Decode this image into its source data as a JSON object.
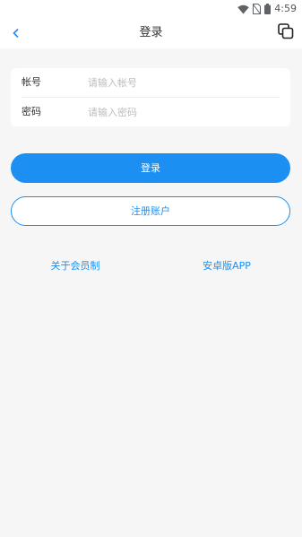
{
  "status_bar": {
    "time": "4:59",
    "icons": [
      "wifi-icon",
      "no-sim-icon",
      "battery-icon"
    ]
  },
  "nav": {
    "title": "登录",
    "back_icon": "chevron-left-icon",
    "action_icon": "copy-window-icon"
  },
  "form": {
    "account": {
      "label": "帐号",
      "value": "",
      "placeholder": "请输入帐号"
    },
    "password": {
      "label": "密码",
      "value": "",
      "placeholder": "请输入密码"
    }
  },
  "buttons": {
    "login": "登录",
    "register": "注册账户"
  },
  "links": {
    "about": "关于会员制",
    "android_app": "安卓版APP"
  },
  "colors": {
    "accent": "#1c8ff2",
    "background": "#f6f6f7",
    "card": "#ffffff"
  }
}
